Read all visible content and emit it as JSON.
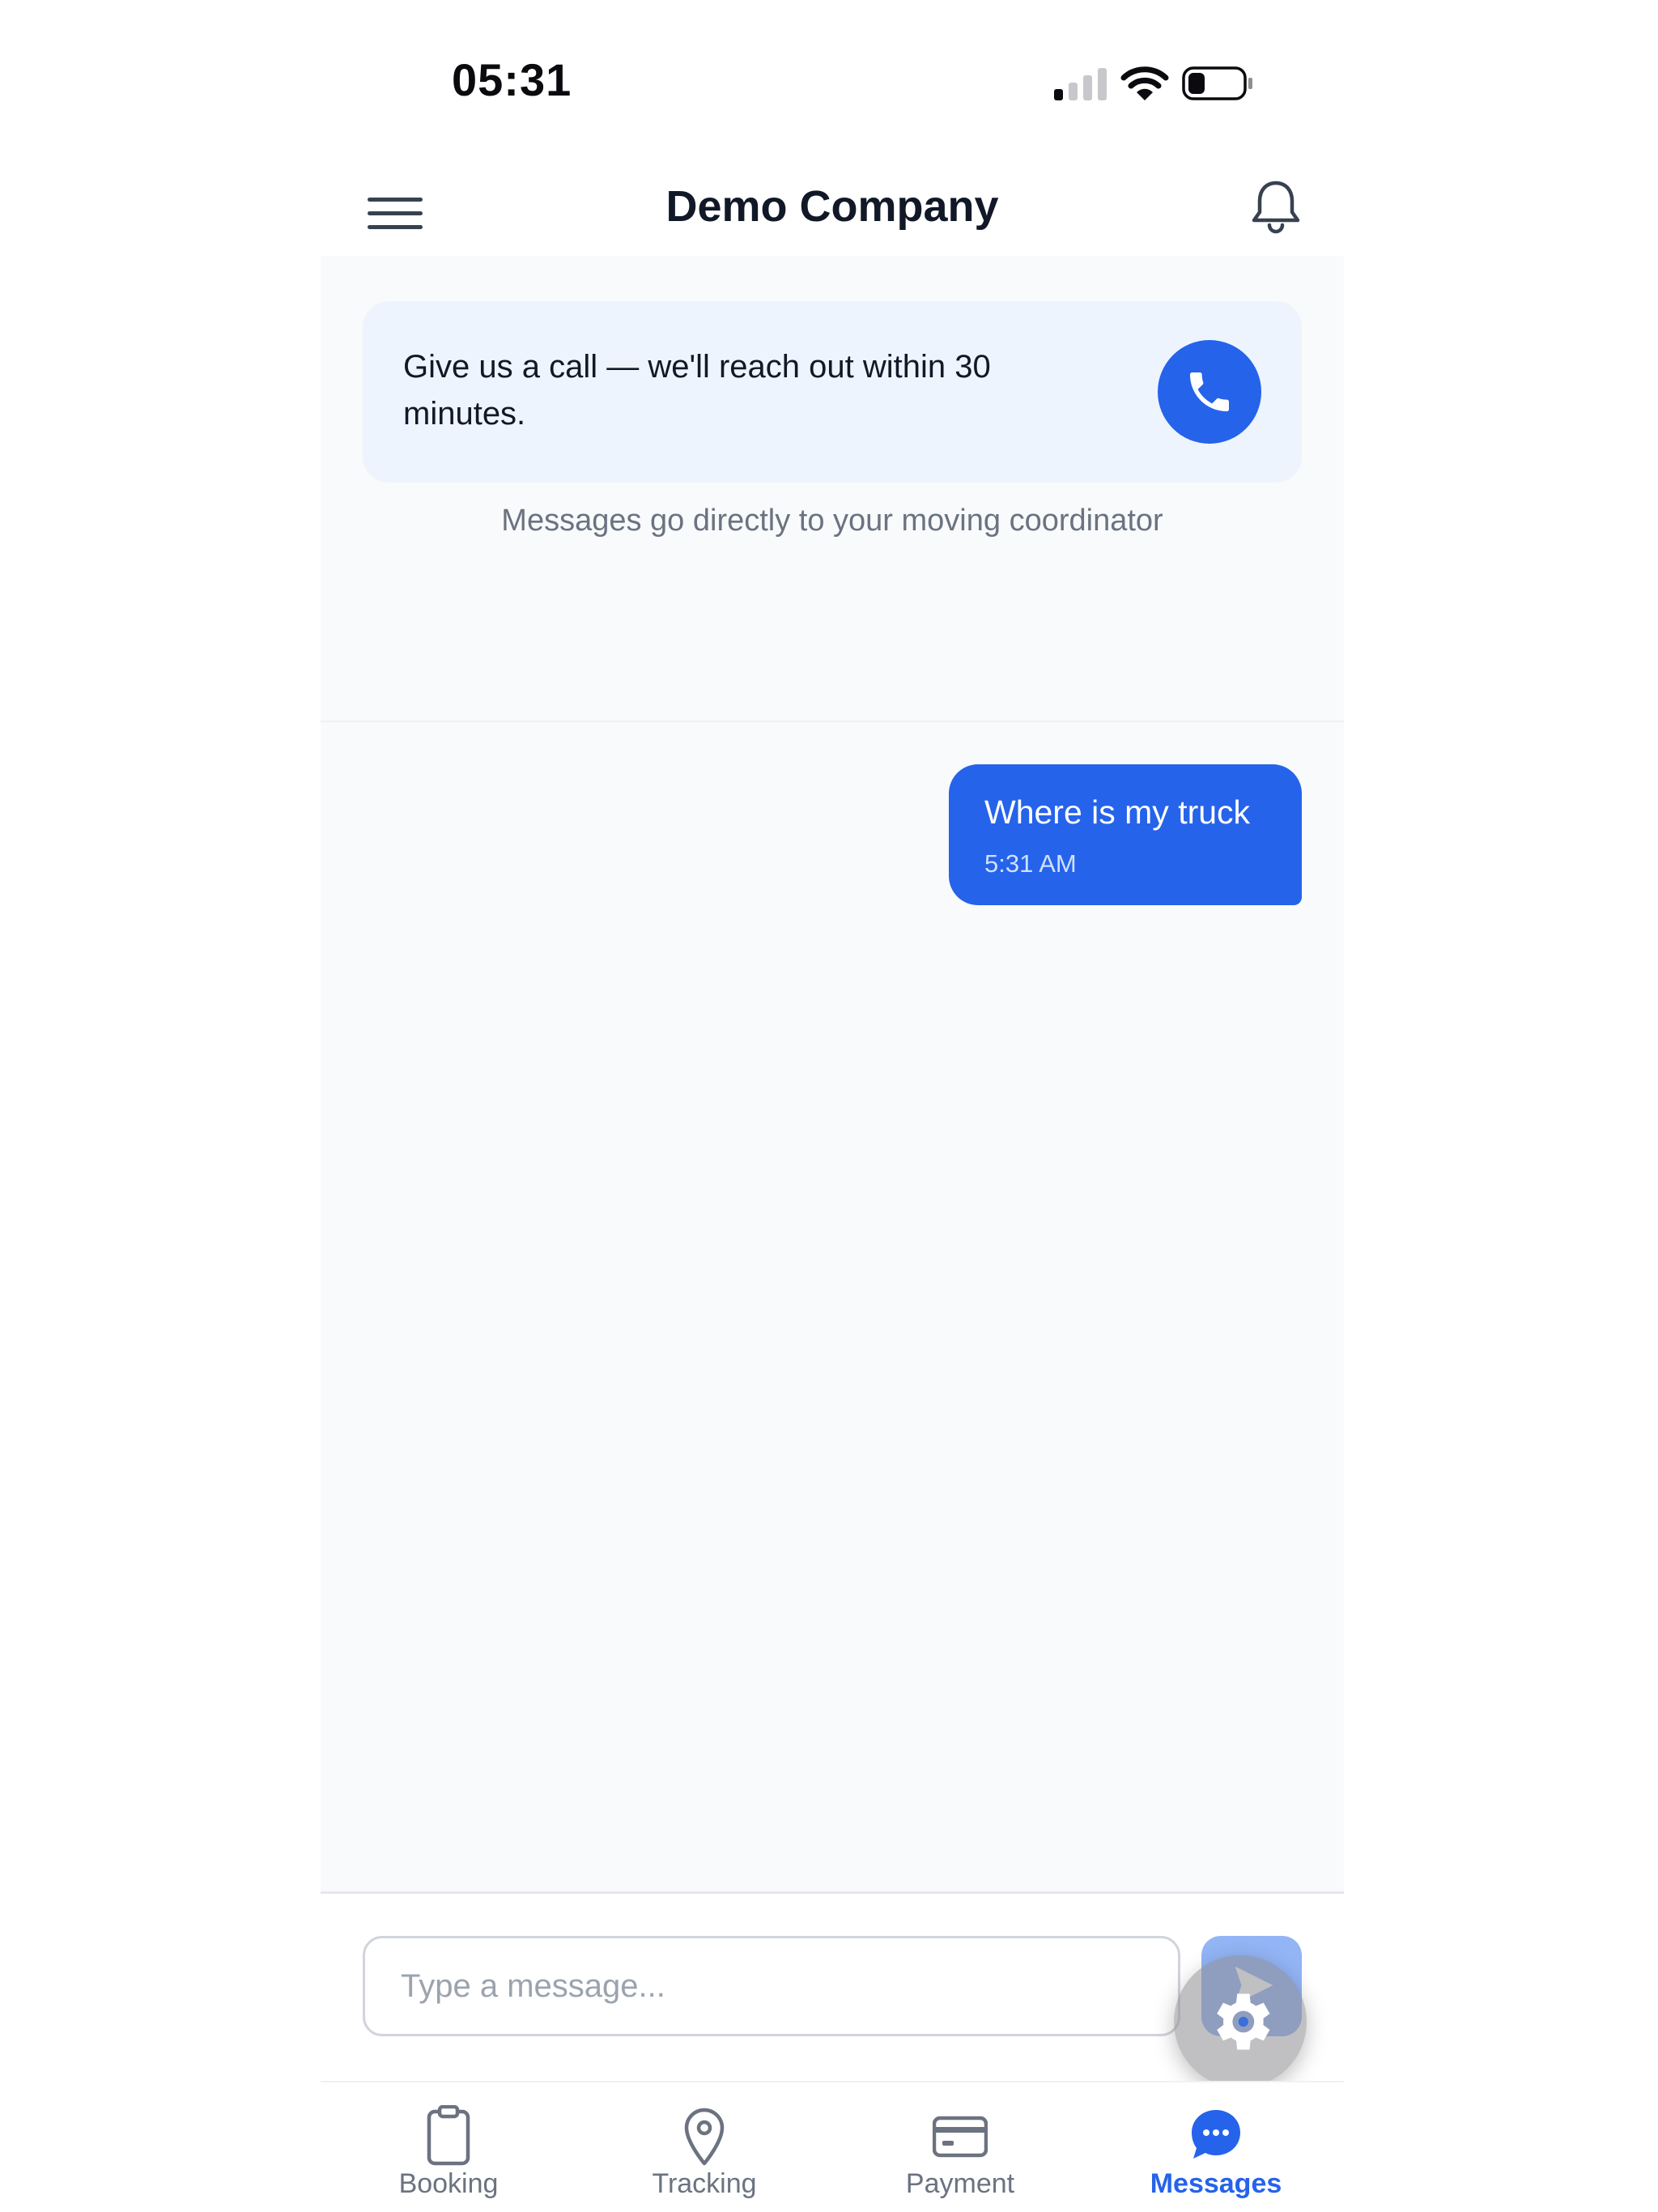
{
  "status_bar": {
    "time": "05:31"
  },
  "header": {
    "title": "Demo Company"
  },
  "call_card": {
    "text": "Give us a call — we'll reach out within 30 minutes."
  },
  "info_note": "Messages go directly to your moving coordinator",
  "messages": [
    {
      "text": "Where is my truck",
      "time": "5:31 AM",
      "sender": "user"
    }
  ],
  "composer": {
    "placeholder": "Type a message..."
  },
  "nav": {
    "items": [
      {
        "label": "Booking",
        "icon": "clipboard-icon"
      },
      {
        "label": "Tracking",
        "icon": "map-pin-icon"
      },
      {
        "label": "Payment",
        "icon": "credit-card-icon"
      },
      {
        "label": "Messages",
        "icon": "chat-bubble-icon",
        "active": true
      }
    ]
  },
  "colors": {
    "accent": "#2563eb",
    "card_background": "#eef4fd",
    "app_background": "#f8fafc",
    "muted_text": "#6b7280"
  }
}
